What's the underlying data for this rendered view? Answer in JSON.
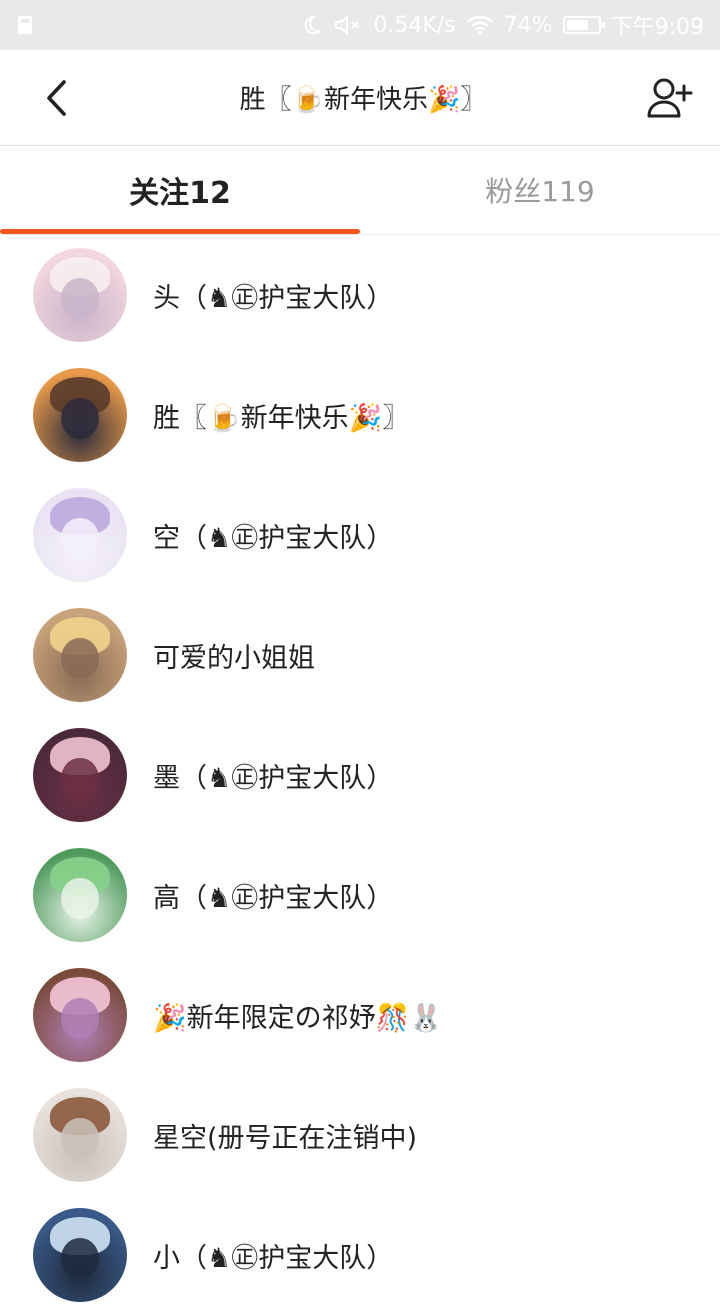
{
  "status_bar": {
    "moon_icon": "moon-icon",
    "mute_icon": "speaker-mute-icon",
    "speed": "0.54K/s",
    "wifi_icon": "wifi-icon",
    "battery": "74%",
    "battery_level": 0.74,
    "time": "下午9:09"
  },
  "header": {
    "back_icon": "chevron-left-icon",
    "title": "胜〖🍺新年快乐🎉〗",
    "follow_icon": "add-user-icon"
  },
  "tabs": [
    {
      "label": "关注12",
      "active": true
    },
    {
      "label": "粉丝119",
      "active": false
    }
  ],
  "accent_color": "#f4571d",
  "users": [
    {
      "name": "头（♞㊣护宝大队）",
      "avatar_colors": [
        "#f3d7df",
        "#f7eef0",
        "#c9b4c9"
      ]
    },
    {
      "name": "胜〖🍺新年快乐🎉〗",
      "avatar_colors": [
        "#e89a4a",
        "#5a3b2a",
        "#2b2b3b"
      ]
    },
    {
      "name": "空（♞㊣护宝大队）",
      "avatar_colors": [
        "#e8e2f3",
        "#bda9de",
        "#f5f1fa"
      ]
    },
    {
      "name": "可爱的小姐姐",
      "avatar_colors": [
        "#c9a47a",
        "#f2d38c",
        "#8a6a55"
      ]
    },
    {
      "name": "墨（♞㊣护宝大队）",
      "avatar_colors": [
        "#4a2a3a",
        "#f1c3cf",
        "#6b2f45"
      ]
    },
    {
      "name": "高（♞㊣护宝大队）",
      "avatar_colors": [
        "#4e9a5b",
        "#86d28a",
        "#e8f3e8"
      ]
    },
    {
      "name": "🎉新年限定の祁妤🎊🐰",
      "avatar_colors": [
        "#7a4b3a",
        "#f4c6d6",
        "#b07fb4"
      ]
    },
    {
      "name": "星空(册号正在注销中)",
      "avatar_colors": [
        "#e9e2dc",
        "#8b5a3c",
        "#c9c1bb"
      ]
    },
    {
      "name": "小（♞㊣护宝大队）",
      "avatar_colors": [
        "#3a5b8a",
        "#cfe2f5",
        "#1e2a3d"
      ]
    }
  ]
}
